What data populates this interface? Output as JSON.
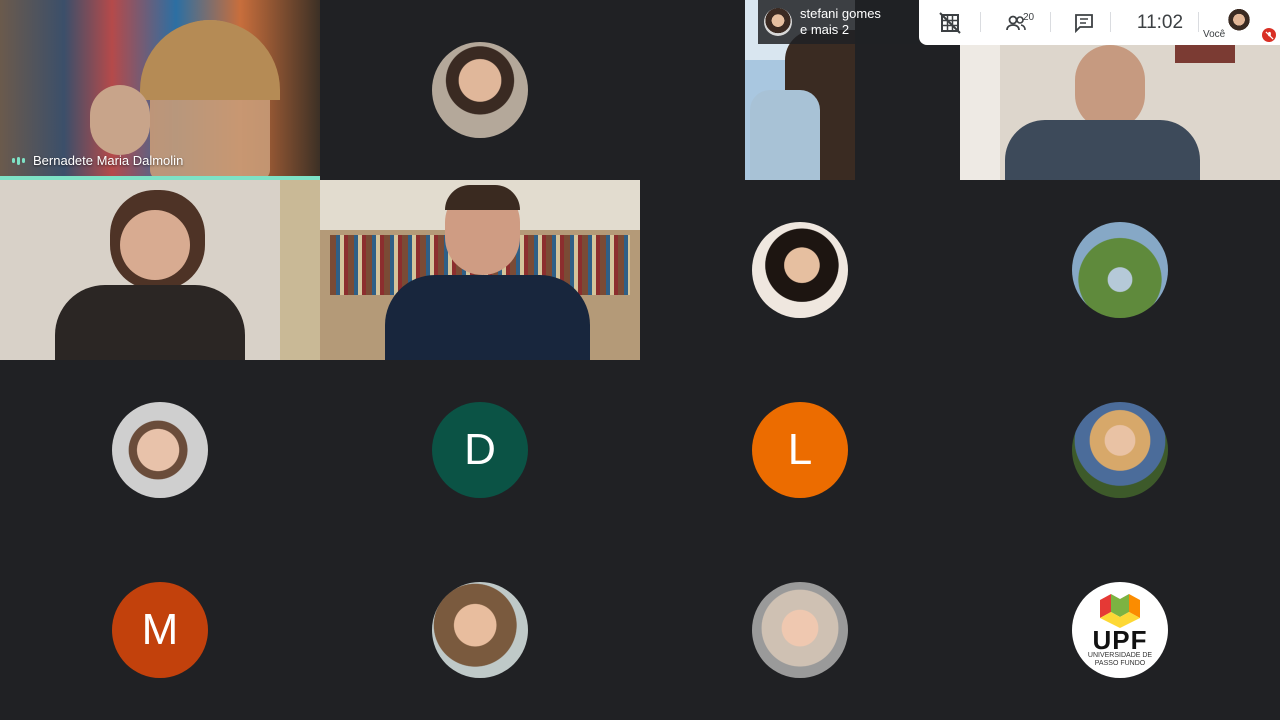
{
  "meeting": {
    "presenter_chip": {
      "line1": "stefani gomes",
      "line2": "e mais 2"
    },
    "toolbar": {
      "layout_icon": "grid-off-icon",
      "people_icon": "people-icon",
      "people_count": "20",
      "chat_icon": "chat-icon",
      "time": "11:02",
      "self_label": "Você",
      "mic_status_icon": "mic-off-icon"
    },
    "colors": {
      "background": "#202124",
      "speaking_accent": "#7ee2c6",
      "mic_off": "#d93025"
    }
  },
  "tiles": [
    {
      "name": "Bernadete Maria Dalmolin",
      "type": "video",
      "speaking": true
    },
    {
      "type": "avatar-photo",
      "icon": "participant-photo-avatar"
    },
    {
      "type": "video"
    },
    {
      "type": "video"
    },
    {
      "type": "video"
    },
    {
      "type": "video"
    },
    {
      "type": "avatar-photo",
      "icon": "participant-photo-avatar"
    },
    {
      "type": "avatar-photo",
      "icon": "participant-photo-avatar"
    },
    {
      "type": "avatar-photo",
      "icon": "participant-photo-avatar"
    },
    {
      "type": "avatar-initial",
      "initial": "D",
      "color": "#0b5345"
    },
    {
      "type": "avatar-initial",
      "initial": "L",
      "color": "#ec6c00"
    },
    {
      "type": "avatar-photo",
      "icon": "participant-photo-avatar"
    },
    {
      "type": "avatar-initial",
      "initial": "M",
      "color": "#c2410c"
    },
    {
      "type": "avatar-photo",
      "icon": "participant-photo-avatar"
    },
    {
      "type": "avatar-photo",
      "icon": "participant-photo-avatar"
    },
    {
      "type": "avatar-logo",
      "logo_text": "UPF",
      "logo_subtext": "UNIVERSIDADE DE PASSO FUNDO"
    }
  ]
}
